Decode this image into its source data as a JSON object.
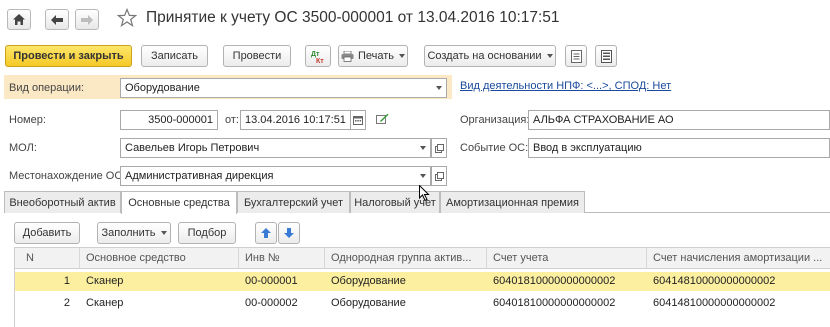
{
  "window": {
    "title": "Принятие к учету ОС 3500-000001 от 13.04.2016 10:17:51"
  },
  "toolbar": {
    "post_and_close": "Провести и закрыть",
    "save": "Записать",
    "post": "Провести",
    "print": "Печать",
    "create_based_on": "Создать на основании"
  },
  "form": {
    "operation_label": "Вид операции:",
    "operation_value": "Оборудование",
    "activity_link": "Вид деятельности НПФ: <...>, СПОД: Нет",
    "number_label": "Номер:",
    "number_value": "3500-000001",
    "date_label": "от:",
    "date_value": "13.04.2016 10:17:51",
    "org_label": "Организация:",
    "org_value": "АЛЬФА СТРАХОВАНИЕ АО",
    "mol_label": "МОЛ:",
    "mol_value": "Савельев Игорь Петрович",
    "event_label": "Событие ОС:",
    "event_value": "Ввод в эксплуатацию",
    "location_label": "Местонахождение ОС:",
    "location_value": "Административная дирекция"
  },
  "tabs": [
    "Внеоборотный актив",
    "Основные средства",
    "Бухгалтерский учет",
    "Налоговый учет",
    "Амортизационная премия"
  ],
  "table_toolbar": {
    "add": "Добавить",
    "fill": "Заполнить",
    "select": "Подбор"
  },
  "table": {
    "columns": [
      "N",
      "Основное средство",
      "Инв №",
      "Однородная группа актив...",
      "Счет учета",
      "Счет начисления амортизации ..."
    ],
    "rows": [
      [
        "1",
        "Сканер",
        "00-000001",
        "Оборудование",
        "60401810000000000002",
        "60414810000000000002"
      ],
      [
        "2",
        "Сканер",
        "00-000002",
        "Оборудование",
        "60401810000000000002",
        "60414810000000000002"
      ]
    ]
  },
  "colors": {
    "primary_button": "#f5c927",
    "operation_highlight": "#fbe8c4",
    "selected_row": "#fcefa0",
    "link": "#1a4a9c"
  }
}
